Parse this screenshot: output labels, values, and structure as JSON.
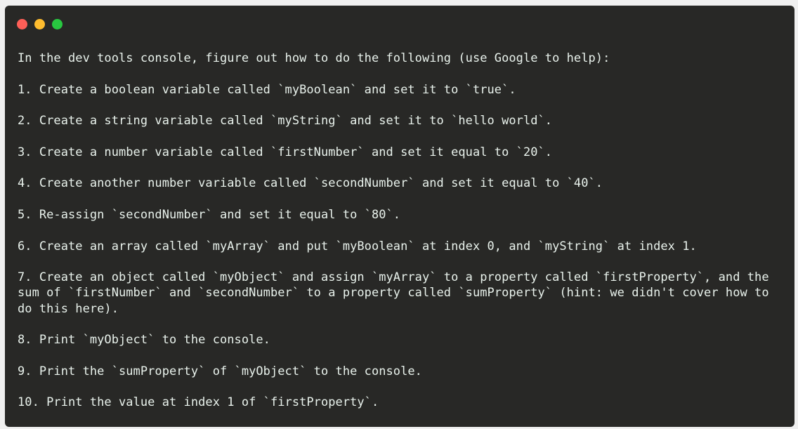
{
  "window": {
    "controls": {
      "close_color": "#fe5f57",
      "minimize_color": "#febc2e",
      "maximize_color": "#28c840"
    },
    "text_color": "#e9f2ec",
    "background_color": "#282826"
  },
  "intro": "In the dev tools console, figure out how to do the following (use Google to help):",
  "items": [
    "1. Create a boolean variable called `myBoolean` and set it to `true`.",
    "2. Create a string variable called `myString` and set it to `hello world`.",
    "3. Create a number variable called `firstNumber` and set it equal to `20`.",
    "4. Create another number variable called `secondNumber` and set it equal to `40`.",
    "5. Re-assign `secondNumber` and set it equal to `80`.",
    "6. Create an array called `myArray` and put `myBoolean` at index 0, and `myString` at index 1.",
    "7. Create an object called `myObject` and assign `myArray` to a property called `firstProperty`, and the sum of `firstNumber` and `secondNumber` to a property called `sumProperty` (hint: we didn't cover how to do this here).",
    "8. Print `myObject` to the console.",
    "9. Print the `sumProperty` of `myObject` to the console.",
    "10. Print the value at index 1 of `firstProperty`."
  ]
}
